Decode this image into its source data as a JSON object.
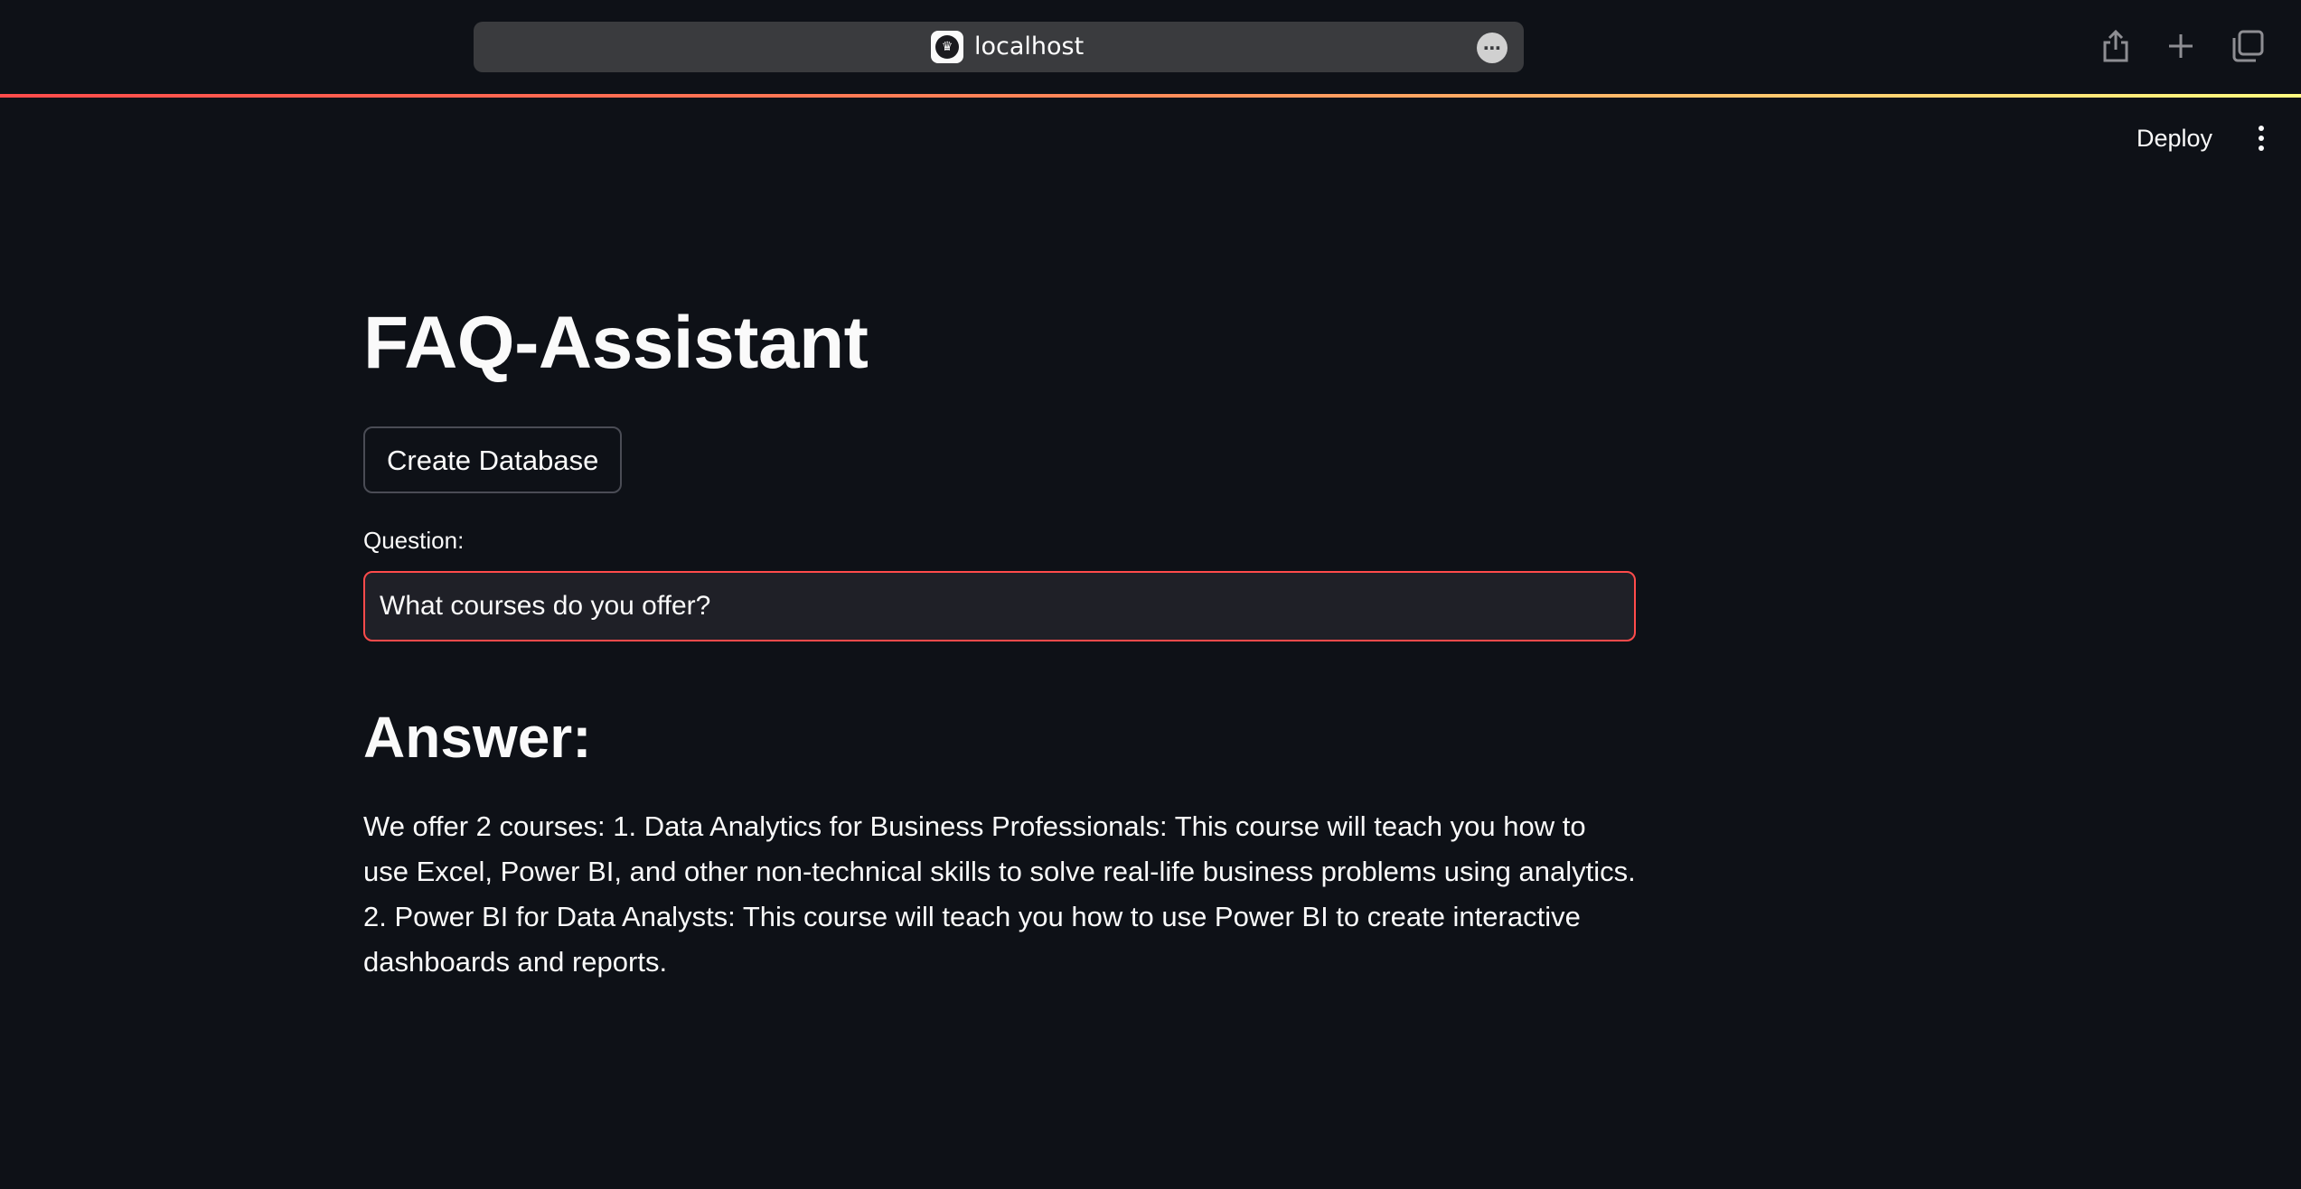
{
  "browser": {
    "url": "localhost",
    "site_icon": "streamlit-crown-icon",
    "more_icon": "more-horizontal-icon",
    "share_icon": "share-icon",
    "new_tab_icon": "plus-icon",
    "tabs_icon": "tabs-overview-icon"
  },
  "header": {
    "deploy_label": "Deploy",
    "menu_icon": "kebab-menu-icon"
  },
  "main": {
    "title": "FAQ-Assistant",
    "create_db_label": "Create Database",
    "question_label": "Question:",
    "question_value": "What courses do you offer?",
    "answer_heading": "Answer:",
    "answer_text": "We offer 2 courses: 1. Data Analytics for Business Professionals: This course will teach you how to use Excel, Power BI, and other non-technical skills to solve real-life business problems using analytics. 2. Power BI for Data Analysts: This course will teach you how to use Power BI to create interactive dashboards and reports."
  },
  "colors": {
    "background": "#0e1117",
    "accent": "#ff4b4b",
    "input_bg": "#1f2027"
  }
}
